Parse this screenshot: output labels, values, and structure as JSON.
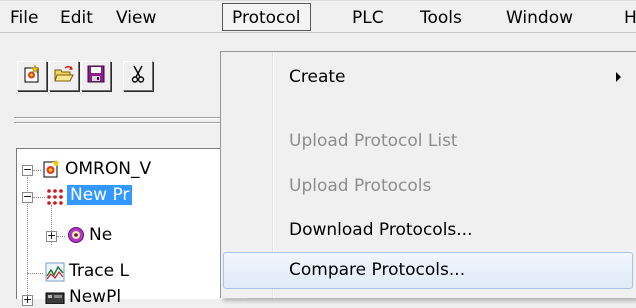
{
  "menubar": {
    "items": [
      "File",
      "Edit",
      "View",
      "Protocol",
      "PLC",
      "Tools",
      "Window",
      "H"
    ],
    "active": "Protocol"
  },
  "toolbar": {
    "buttons": [
      "new-project-icon",
      "open-folder-icon",
      "save-icon",
      "cut-icon"
    ]
  },
  "tree": {
    "root": "OMRON_V",
    "selected_child": "New Pr",
    "grandchild": "Ne",
    "trace": "Trace L",
    "last": "NewPl"
  },
  "dropdown": {
    "items": [
      {
        "label": "Create",
        "enabled": true,
        "submenu": true
      },
      {
        "label": "Upload Protocol List",
        "enabled": false
      },
      {
        "label": "Upload Protocols",
        "enabled": false
      },
      {
        "label": "Download Protocols...",
        "enabled": true
      },
      {
        "label": "Compare Protocols...",
        "enabled": true,
        "highlighted": true
      }
    ]
  },
  "colors": {
    "selection": "#3399ff",
    "menu_hover_border": "#a8c3e6",
    "disabled_text": "#8d8d8d"
  }
}
